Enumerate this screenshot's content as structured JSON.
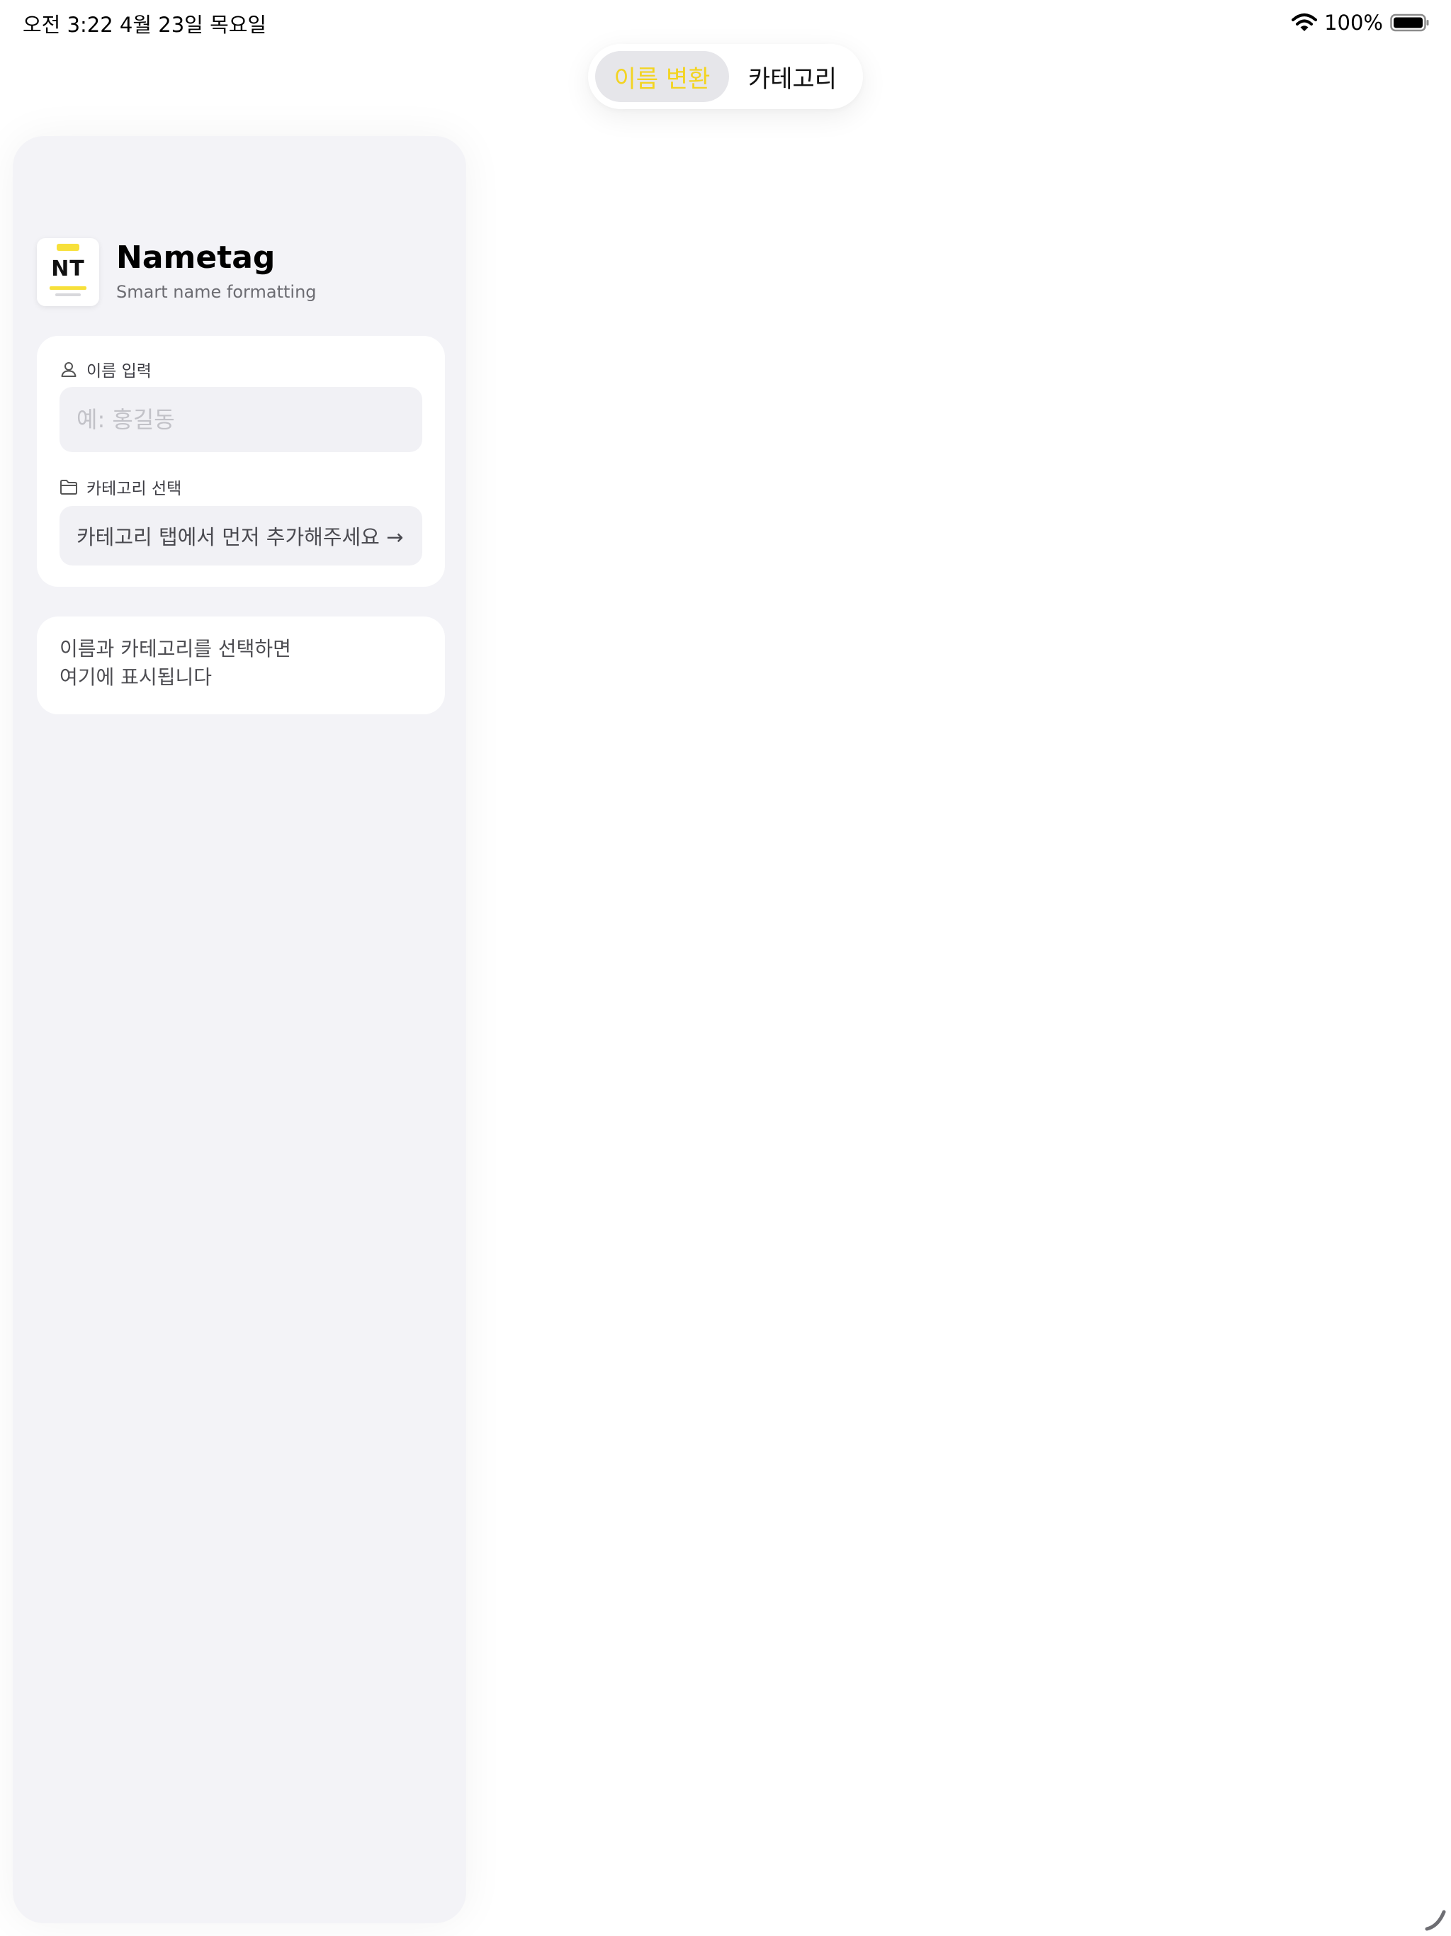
{
  "status_bar": {
    "time_date": "오전 3:22   4월 23일 목요일",
    "battery_percent": "100%",
    "icons": [
      "wifi-icon",
      "battery-icon"
    ]
  },
  "segmented_control": {
    "tabs": [
      {
        "label": "이름 변환",
        "selected": true
      },
      {
        "label": "카테고리",
        "selected": false
      }
    ]
  },
  "app": {
    "logo_text": "NT",
    "title": "Nametag",
    "subtitle": "Smart name formatting"
  },
  "form": {
    "name_label": "이름 입력",
    "name_placeholder": "예: 홍길동",
    "name_value": "",
    "category_label": "카테고리 선택",
    "category_hint": "카테고리 탭에서 먼저 추가해주세요 →"
  },
  "result": {
    "line1": "이름과 카테고리를 선택하면",
    "line2": "여기에 표시됩니다"
  },
  "colors": {
    "accent": "#f3d421",
    "sidebar_bg": "#f3f3f7",
    "card_bg": "#ffffff",
    "input_bg": "#f1f1f5"
  }
}
